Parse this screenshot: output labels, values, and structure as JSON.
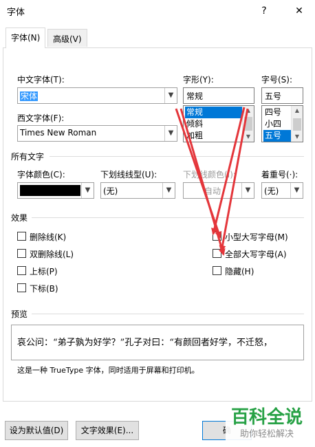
{
  "window": {
    "title": "字体",
    "help_glyph": "?",
    "close_glyph": "✕"
  },
  "tabs": [
    {
      "label": "字体(N)",
      "active": true
    },
    {
      "label": "高级(V)",
      "active": false
    }
  ],
  "font": {
    "chinese_label": "中文字体(T):",
    "chinese_value": "宋体",
    "western_label": "西文字体(F):",
    "western_value": "Times New Roman",
    "style_label": "字形(Y):",
    "style_value": "常规",
    "style_list": [
      "常规",
      "倾斜",
      "加粗"
    ],
    "size_label": "字号(S):",
    "size_value": "五号",
    "size_list": [
      "四号",
      "小四",
      "五号"
    ]
  },
  "all_text": {
    "section_label": "所有文字",
    "color_label": "字体颜色(C):",
    "color_value": "#000000",
    "underline_label": "下划线线型(U):",
    "underline_value": "(无)",
    "underline_color_label": "下划线颜色(I):",
    "underline_color_value": "自动",
    "emphasis_label": "着重号(·):",
    "emphasis_value": "(无)"
  },
  "effects": {
    "section_label": "效果",
    "left": [
      "删除线(K)",
      "双删除线(L)",
      "上标(P)",
      "下标(B)"
    ],
    "right": [
      "小型大写字母(M)",
      "全部大写字母(A)",
      "隐藏(H)"
    ]
  },
  "preview": {
    "section_label": "预览",
    "text": "哀公问：“弟子孰为好学？”孔子对曰：“有颜回者好学，不迁怒，",
    "note": "这是一种 TrueType 字体，同时适用于屏幕和打印机。"
  },
  "buttons": {
    "set_default": "设为默认值(D)",
    "text_effects": "文字效果(E)...",
    "ok": "确"
  },
  "watermark": {
    "brand": "百科全说",
    "slogan": "助你轻松解决"
  },
  "colors": {
    "selection": "#0078d7",
    "arrow": "#e4363b",
    "watermark_green": "#27a145"
  },
  "icons": {
    "dropdown": "chevron-down-icon",
    "help": "help-icon",
    "close": "close-icon"
  }
}
